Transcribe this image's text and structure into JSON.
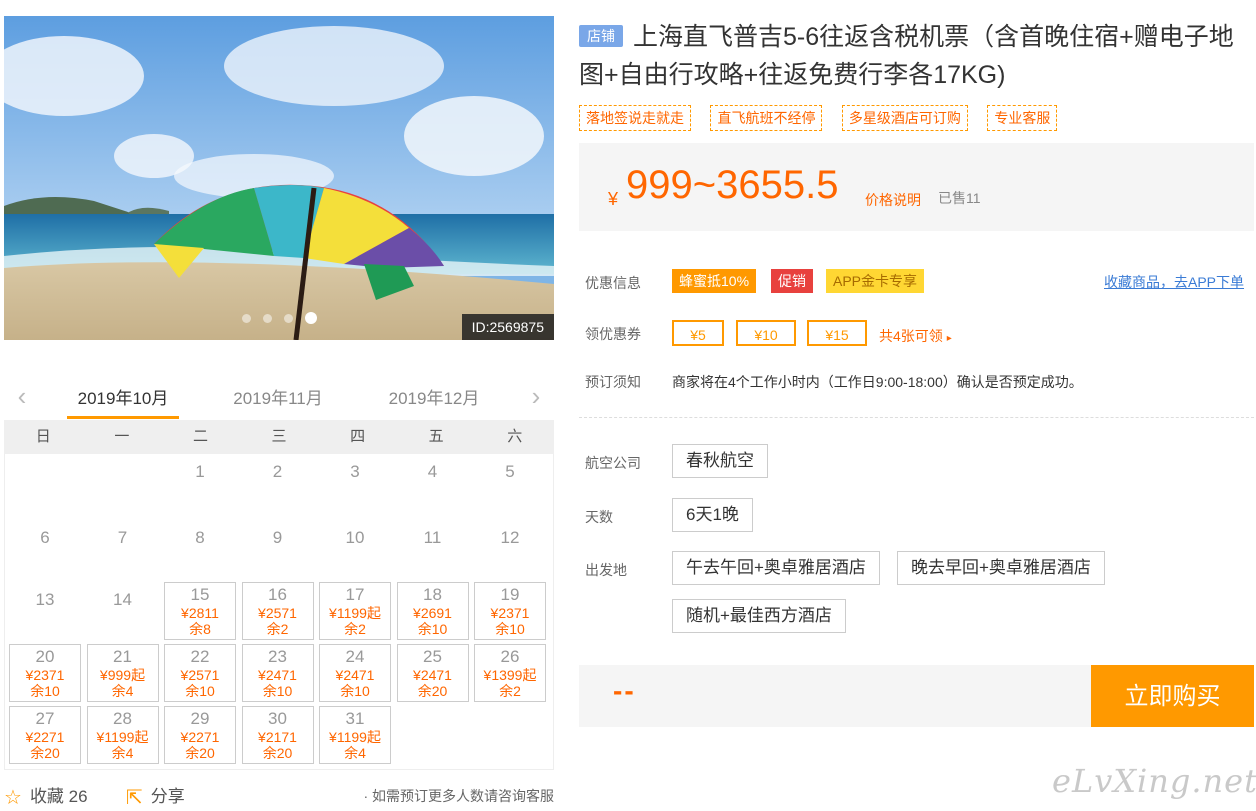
{
  "product": {
    "shop_tag": "店铺",
    "title": "上海直飞普吉5-6往返含税机票（含首晚住宿+赠电子地图+自由行攻略+往返免费行李各17KG)",
    "tags": [
      "落地签说走就走",
      "直飞航班不经停",
      "多星级酒店可订购",
      "专业客服"
    ],
    "image_id": "ID:2569875",
    "image_dots": 4,
    "image_active_dot": 4
  },
  "price": {
    "currency": "¥",
    "range": "999~3655.5",
    "note": "价格说明",
    "sold": "已售11"
  },
  "promotions": {
    "label": "优惠信息",
    "badges": [
      "蜂蜜抵10%",
      "促销",
      "APP金卡专享"
    ],
    "fav_link": "收藏商品，去APP下单"
  },
  "coupons": {
    "label": "领优惠券",
    "items": [
      "¥5",
      "¥10",
      "¥15"
    ],
    "more": "共4张可领"
  },
  "booking_notice": {
    "label": "预订须知",
    "text": "商家将在4个工作小时内（工作日9:00-18:00）确认是否预定成功。"
  },
  "options": {
    "airline": {
      "label": "航空公司",
      "values": [
        "春秋航空"
      ]
    },
    "days": {
      "label": "天数",
      "values": [
        "6天1晚"
      ]
    },
    "departure": {
      "label": "出发地",
      "values": [
        "午去午回+奥卓雅居酒店",
        "晚去早回+奥卓雅居酒店",
        "随机+最佳西方酒店"
      ]
    }
  },
  "buy": {
    "selected_price": "--",
    "button": "立即购买"
  },
  "calendar": {
    "months": [
      "2019年10月",
      "2019年11月",
      "2019年12月"
    ],
    "active_month": "2019年10月",
    "weekdays": [
      "日",
      "一",
      "二",
      "三",
      "四",
      "五",
      "六"
    ],
    "first_weekday": 2,
    "days": [
      {
        "d": "1"
      },
      {
        "d": "2"
      },
      {
        "d": "3"
      },
      {
        "d": "4"
      },
      {
        "d": "5"
      },
      {
        "d": "6"
      },
      {
        "d": "7"
      },
      {
        "d": "8"
      },
      {
        "d": "9"
      },
      {
        "d": "10"
      },
      {
        "d": "11"
      },
      {
        "d": "12"
      },
      {
        "d": "13"
      },
      {
        "d": "14"
      },
      {
        "d": "15",
        "p": "¥2811",
        "r": "余8"
      },
      {
        "d": "16",
        "p": "¥2571",
        "r": "余2"
      },
      {
        "d": "17",
        "p": "¥1199起",
        "r": "余2"
      },
      {
        "d": "18",
        "p": "¥2691",
        "r": "余10"
      },
      {
        "d": "19",
        "p": "¥2371",
        "r": "余10"
      },
      {
        "d": "20",
        "p": "¥2371",
        "r": "余10"
      },
      {
        "d": "21",
        "p": "¥999起",
        "r": "余4"
      },
      {
        "d": "22",
        "p": "¥2571",
        "r": "余10"
      },
      {
        "d": "23",
        "p": "¥2471",
        "r": "余10"
      },
      {
        "d": "24",
        "p": "¥2471",
        "r": "余10"
      },
      {
        "d": "25",
        "p": "¥2471",
        "r": "余20"
      },
      {
        "d": "26",
        "p": "¥1399起",
        "r": "余2"
      },
      {
        "d": "27",
        "p": "¥2271",
        "r": "余20"
      },
      {
        "d": "28",
        "p": "¥1199起",
        "r": "余4"
      },
      {
        "d": "29",
        "p": "¥2271",
        "r": "余20"
      },
      {
        "d": "30",
        "p": "¥2171",
        "r": "余20"
      },
      {
        "d": "31",
        "p": "¥1199起",
        "r": "余4"
      }
    ]
  },
  "footer": {
    "favorite": "收藏 26",
    "share": "分享",
    "note": "· 如需预订更多人数请咨询客服"
  },
  "watermark": "eLvXing.net",
  "colors": {
    "accent": "#ff9900",
    "price": "#ff6600",
    "link": "#3a7bd5",
    "shop_tag": "#7aa7e8"
  }
}
